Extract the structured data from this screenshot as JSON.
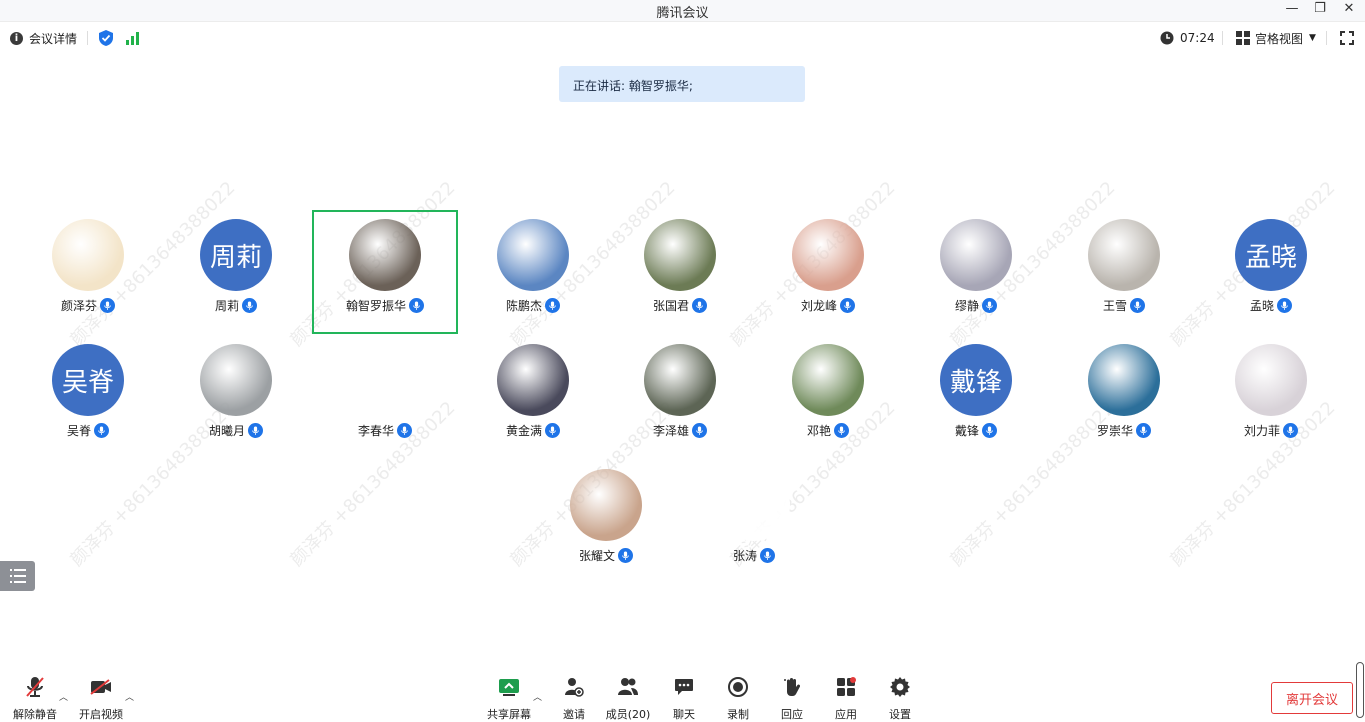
{
  "window": {
    "title": "腾讯会议",
    "controls": [
      "—",
      "❐",
      "✕"
    ]
  },
  "topbar": {
    "meeting_details": "会议详情",
    "timer": "07:24",
    "view_mode": "宫格视图",
    "icons": [
      "info-icon",
      "shield-check-icon",
      "signal-bars-icon",
      "clock-icon",
      "grid-view-icon",
      "fullscreen-icon"
    ]
  },
  "speaking": {
    "text": "正在讲话: 翰智罗振华;"
  },
  "watermark": "颜泽芬 +8613648388022",
  "participants": [
    {
      "name": "颜泽芬",
      "avatar": "image",
      "color": "#f3e4c8"
    },
    {
      "name": "周莉",
      "avatar_text": "周莉",
      "color": "#3e6fc3"
    },
    {
      "name": "翰智罗振华",
      "avatar": "image",
      "color": "#6b6158",
      "speaking": true
    },
    {
      "name": "陈鹏杰",
      "avatar": "image",
      "color": "#5b86c2"
    },
    {
      "name": "张国君",
      "avatar": "image",
      "color": "#6c7b55"
    },
    {
      "name": "刘龙峰",
      "avatar": "image",
      "color": "#d99f8d"
    },
    {
      "name": "缪静",
      "avatar": "image",
      "color": "#a7a6b6"
    },
    {
      "name": "王雪",
      "avatar": "image",
      "color": "#b9b4ad"
    },
    {
      "name": "孟晓",
      "avatar_text": "孟晓",
      "color": "#3e6fc3"
    },
    {
      "name": "吴脊",
      "avatar_text": "吴脊",
      "color": "#3e6fc3"
    },
    {
      "name": "胡曦月",
      "avatar": "image",
      "color": "#9ca0a3"
    },
    {
      "name": "李春华",
      "avatar": "image",
      "color": "#ffffff"
    },
    {
      "name": "黄金满",
      "avatar": "image",
      "color": "#4a4a5c"
    },
    {
      "name": "李泽雄",
      "avatar": "image",
      "color": "#5d6555"
    },
    {
      "name": "邓艳",
      "avatar": "image",
      "color": "#6f8a5a"
    },
    {
      "name": "戴锋",
      "avatar_text": "戴锋",
      "color": "#3e6fc3"
    },
    {
      "name": "罗崇华",
      "avatar": "image",
      "color": "#2c6f9a"
    },
    {
      "name": "刘力菲",
      "avatar": "image",
      "color": "#d8d2d8"
    },
    {
      "name": "张耀文",
      "avatar": "image",
      "color": "#c9a48c"
    },
    {
      "name": "张涛",
      "avatar": "image",
      "color": "#ffffff"
    }
  ],
  "bottombar": {
    "unmute": "解除静音",
    "start_video": "开启视频",
    "share_screen": "共享屏幕",
    "invite": "邀请",
    "members": "成员(20)",
    "chat": "聊天",
    "record": "录制",
    "reactions": "回应",
    "apps": "应用",
    "settings": "设置",
    "leave": "离开会议"
  },
  "colors": {
    "accent": "#1f74e8",
    "speaking_border": "#22b55a",
    "leave": "#e23a3a",
    "share_green": "#1d9d4d"
  }
}
